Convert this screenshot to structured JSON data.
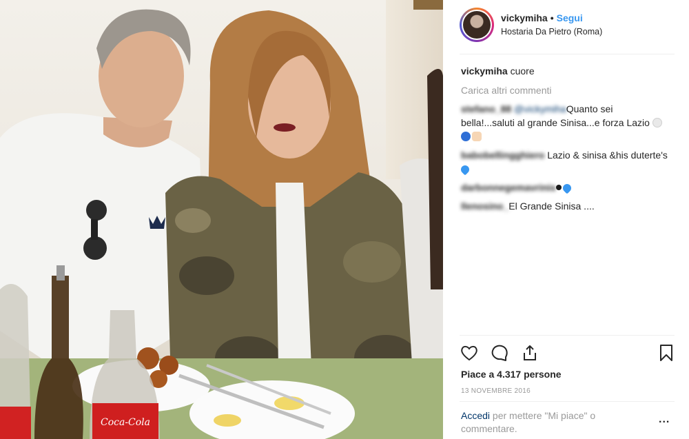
{
  "post": {
    "username": "vickymiha",
    "separator": "•",
    "follow_label": "Segui",
    "location": "Hostaria Da Pietro (Roma)"
  },
  "caption": {
    "username": "vickymiha",
    "text": "cuore"
  },
  "load_more_label": "Carica altri commenti",
  "comments": [
    {
      "user": "stefano_88",
      "mention": "@vickymiha",
      "text": "Quanto sei bella!...saluti al grande Sinisa...e forza Lazio"
    },
    {
      "user": "babobellingghiero",
      "text": "Lazio & sinisa &his duterte's"
    },
    {
      "user": "darbonnegemavrinis",
      "text": ""
    },
    {
      "user": "llenosino_",
      "text": "El Grande Sinisa ...."
    }
  ],
  "icons": {
    "like": "heart-icon",
    "comment": "comment-bubble-icon",
    "share": "share-icon",
    "save": "bookmark-icon",
    "more": "ellipsis-icon"
  },
  "likes_text": "Piace a 4.317 persone",
  "date": "13 NOVEMBRE 2016",
  "login": {
    "link": "Accedi",
    "text": "per mettere \"Mi piace\" o commentare."
  },
  "more_label": "...",
  "colors": {
    "accent_blue": "#3897f0",
    "link_dark": "#003569",
    "muted": "#999999",
    "heart_blue": "#3897f0"
  }
}
